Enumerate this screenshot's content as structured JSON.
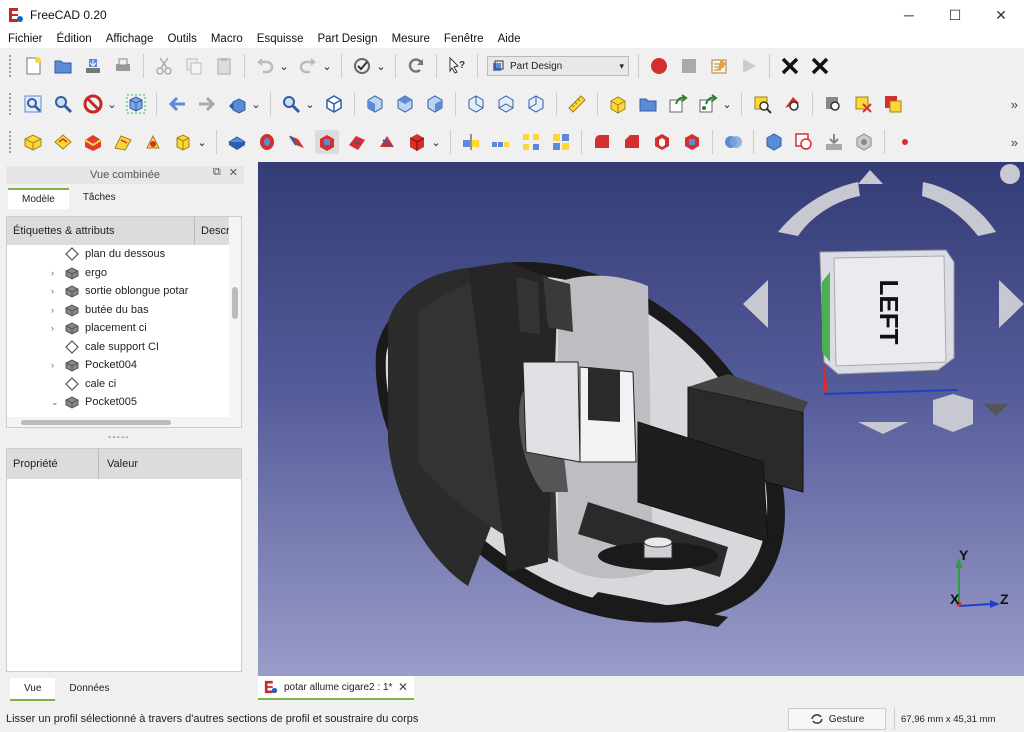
{
  "window": {
    "title": "FreeCAD 0.20",
    "controls": {
      "minimize": "─",
      "maximize": "☐",
      "close": "✕"
    }
  },
  "menu": [
    "Fichier",
    "Édition",
    "Affichage",
    "Outils",
    "Macro",
    "Esquisse",
    "Part Design",
    "Mesure",
    "Fenêtre",
    "Aide"
  ],
  "toolbar": {
    "workbench_selected": "Part Design",
    "overflow": "»"
  },
  "combo_view": {
    "title": "Vue combinée",
    "float_btn": "⧉",
    "close_btn": "✕",
    "tabs": [
      "Modèle",
      "Tâches"
    ],
    "tree_headers": [
      "Étiquettes & attributs",
      "Description"
    ],
    "tree_items": [
      {
        "label": "plan du dessous",
        "type": "datum",
        "expand": ""
      },
      {
        "label": "ergo",
        "type": "body",
        "expand": "›"
      },
      {
        "label": "sortie oblongue potar",
        "type": "body",
        "expand": "›"
      },
      {
        "label": "butée du bas",
        "type": "body",
        "expand": "›"
      },
      {
        "label": "placement ci",
        "type": "body",
        "expand": "›"
      },
      {
        "label": "cale support CI",
        "type": "datum",
        "expand": ""
      },
      {
        "label": "Pocket004",
        "type": "body",
        "expand": "›"
      },
      {
        "label": "cale ci",
        "type": "datum",
        "expand": ""
      },
      {
        "label": "Pocket005",
        "type": "body",
        "expand": "⌄"
      }
    ],
    "splitter": "-----",
    "prop_headers": [
      "Propriété",
      "Valeur"
    ],
    "bottom_tabs": [
      "Vue",
      "Données"
    ]
  },
  "viewport": {
    "navcube_face": "LEFT",
    "axes": {
      "x": "X",
      "y": "Y",
      "z": "Z"
    }
  },
  "document_tab": {
    "label": "potar allume cigare2 : 1*",
    "close": "✕"
  },
  "status": {
    "message": "Lisser un profil sélectionné à travers d'autres sections de profil et soustraire du corps",
    "nav_style": "Gesture",
    "dimensions": "67,96 mm x 45,31 mm"
  },
  "colors": {
    "active_tab": "#7cb342",
    "macro_record": "#d32f2f",
    "viewport_top": "#333c76",
    "viewport_bottom": "#9a9cc8",
    "part_dark": "#2a2a2a",
    "part_light": "#e0e0e4"
  }
}
